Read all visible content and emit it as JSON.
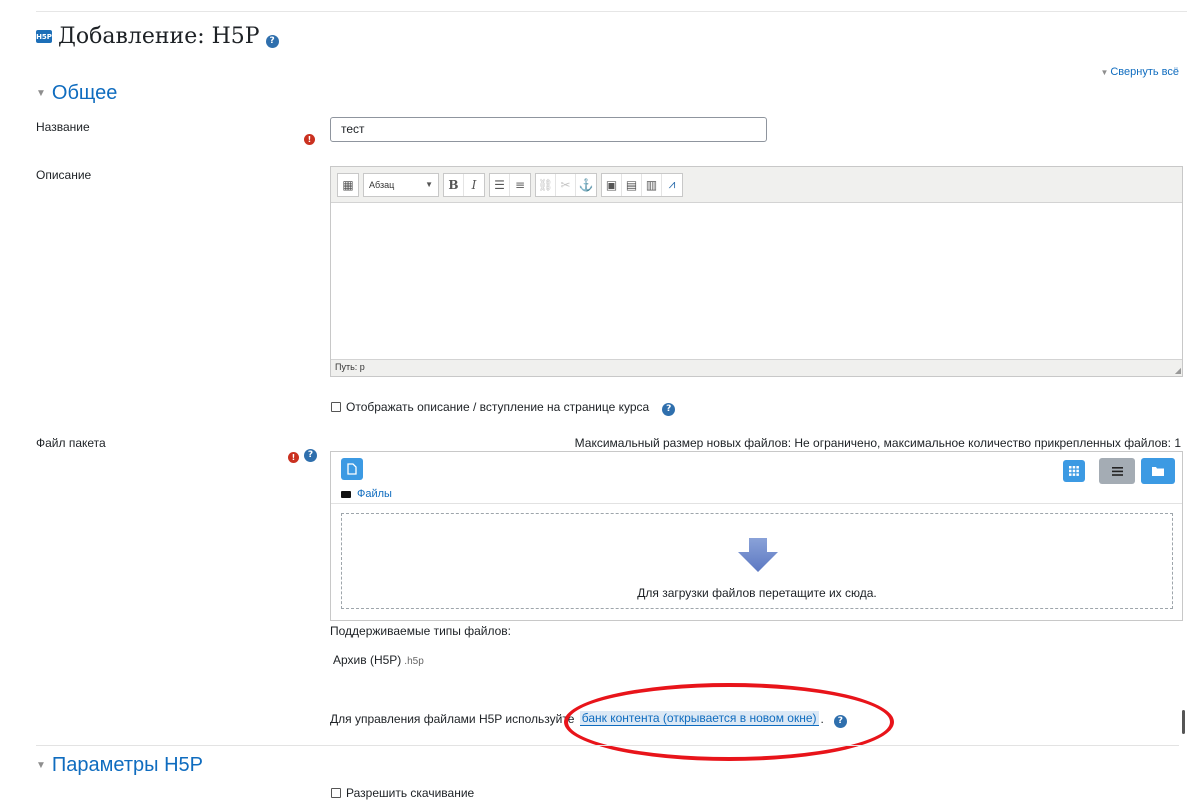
{
  "page": {
    "badge": "H5P",
    "title": "Добавление: H5P",
    "collapse_all": "Свернуть всё"
  },
  "sections": {
    "general": "Общее",
    "h5p_params": "Параметры H5P"
  },
  "fields": {
    "name_label": "Название",
    "name_value": "тест",
    "description_label": "Описание",
    "package_label": "Файл пакета"
  },
  "editor": {
    "format_select": "Абзац",
    "bold": "B",
    "italic": "I",
    "status_path": "Путь: p"
  },
  "show_description": "Отображать описание / вступление на странице курса",
  "filepicker": {
    "limit_text": "Максимальный размер новых файлов: Не ограничено, максимальное количество прикрепленных файлов: 1",
    "folder_link": "Файлы",
    "drop_text": "Для загрузки файлов перетащите их сюда."
  },
  "supported": {
    "label": "Поддерживаемые типы файлов:",
    "archive_name": "Архив (H5P)",
    "archive_ext": ".h5p"
  },
  "manage": {
    "prefix": "Для управления файлами H5P используйте",
    "link": "банк контента (открывается в новом окне)",
    "suffix": "."
  },
  "allow_download": "Разрешить скачивание",
  "colors": {
    "link": "#0f6cbf",
    "required": "#ca3120",
    "annotation": "#e8141a",
    "button_blue": "#3c9ae3"
  }
}
